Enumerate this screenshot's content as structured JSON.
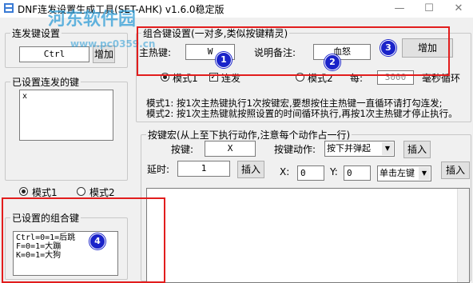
{
  "window": {
    "title": "DNF连发设置生成工具(SET-AHK) v1.6.0稳定版",
    "watermark": "河东软件园",
    "watermark_url": "www.pc0359.cn",
    "minimize_glyph": "—",
    "maximize_glyph": "☐",
    "close_glyph": "✕"
  },
  "left": {
    "burst_group_title": "连发键设置",
    "burst_key_value": "Ctrl",
    "add_label": "增加",
    "set_keys_group_title": "已设置连发的键",
    "set_keys_text": "x",
    "mode1_label": "模式1",
    "mode2_label": "模式2",
    "combo_group_title": "已设置的组合键",
    "combo_text": "Ctrl=0=1=后跳\nF=0=1=大蹦\nK=0=1=大狗"
  },
  "right": {
    "combo_group_title": "组合键设置(一对多,类似按键精灵)",
    "main_hotkey_label": "主热键:",
    "main_hotkey_value": "W",
    "note_label": "说明备注:",
    "note_value": "血怒",
    "add_label": "增加",
    "mode1_label": "模式1",
    "burst_label": "连发",
    "mode2_label": "模式2",
    "every_label": "每:",
    "interval_value": "3000",
    "ms_loop_label": "毫秒循环",
    "desc1": "模式1: 按1次主热键执行1次按键宏,要想按住主热键一直循环请打勾连发;",
    "desc2": "模式2: 按1次主热键就按照设置的时间循环执行,再按1次主热键才停止执行。",
    "macro_group_title": "按键宏(从上至下执行动作,注意每个动作占一行)",
    "key_label": "按键:",
    "key_value": "X",
    "action_label": "按键动作:",
    "action_value": "按下并弹起",
    "insert_label": "插入",
    "delay_label": "延时:",
    "delay_value": "1",
    "x_label": "X:",
    "x_value": "0",
    "y_label": "Y:",
    "y_value": "0",
    "click_value": "单击左键"
  },
  "badges": {
    "b1": "1",
    "b2": "2",
    "b3": "3",
    "b4": "4"
  },
  "colors": {
    "annotation_red": "#e21d1d",
    "badge_blue": "#1a23c9",
    "watermark_blue": "#2a9bd6"
  }
}
